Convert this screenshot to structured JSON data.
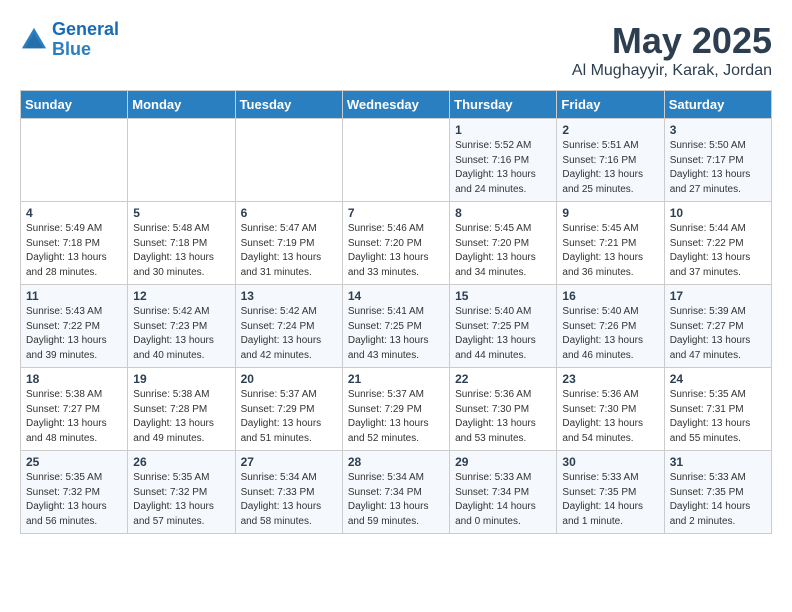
{
  "header": {
    "logo_line1": "General",
    "logo_line2": "Blue",
    "month": "May 2025",
    "location": "Al Mughayyir, Karak, Jordan"
  },
  "weekdays": [
    "Sunday",
    "Monday",
    "Tuesday",
    "Wednesday",
    "Thursday",
    "Friday",
    "Saturday"
  ],
  "weeks": [
    [
      {
        "day": "",
        "info": ""
      },
      {
        "day": "",
        "info": ""
      },
      {
        "day": "",
        "info": ""
      },
      {
        "day": "",
        "info": ""
      },
      {
        "day": "1",
        "info": "Sunrise: 5:52 AM\nSunset: 7:16 PM\nDaylight: 13 hours\nand 24 minutes."
      },
      {
        "day": "2",
        "info": "Sunrise: 5:51 AM\nSunset: 7:16 PM\nDaylight: 13 hours\nand 25 minutes."
      },
      {
        "day": "3",
        "info": "Sunrise: 5:50 AM\nSunset: 7:17 PM\nDaylight: 13 hours\nand 27 minutes."
      }
    ],
    [
      {
        "day": "4",
        "info": "Sunrise: 5:49 AM\nSunset: 7:18 PM\nDaylight: 13 hours\nand 28 minutes."
      },
      {
        "day": "5",
        "info": "Sunrise: 5:48 AM\nSunset: 7:18 PM\nDaylight: 13 hours\nand 30 minutes."
      },
      {
        "day": "6",
        "info": "Sunrise: 5:47 AM\nSunset: 7:19 PM\nDaylight: 13 hours\nand 31 minutes."
      },
      {
        "day": "7",
        "info": "Sunrise: 5:46 AM\nSunset: 7:20 PM\nDaylight: 13 hours\nand 33 minutes."
      },
      {
        "day": "8",
        "info": "Sunrise: 5:45 AM\nSunset: 7:20 PM\nDaylight: 13 hours\nand 34 minutes."
      },
      {
        "day": "9",
        "info": "Sunrise: 5:45 AM\nSunset: 7:21 PM\nDaylight: 13 hours\nand 36 minutes."
      },
      {
        "day": "10",
        "info": "Sunrise: 5:44 AM\nSunset: 7:22 PM\nDaylight: 13 hours\nand 37 minutes."
      }
    ],
    [
      {
        "day": "11",
        "info": "Sunrise: 5:43 AM\nSunset: 7:22 PM\nDaylight: 13 hours\nand 39 minutes."
      },
      {
        "day": "12",
        "info": "Sunrise: 5:42 AM\nSunset: 7:23 PM\nDaylight: 13 hours\nand 40 minutes."
      },
      {
        "day": "13",
        "info": "Sunrise: 5:42 AM\nSunset: 7:24 PM\nDaylight: 13 hours\nand 42 minutes."
      },
      {
        "day": "14",
        "info": "Sunrise: 5:41 AM\nSunset: 7:25 PM\nDaylight: 13 hours\nand 43 minutes."
      },
      {
        "day": "15",
        "info": "Sunrise: 5:40 AM\nSunset: 7:25 PM\nDaylight: 13 hours\nand 44 minutes."
      },
      {
        "day": "16",
        "info": "Sunrise: 5:40 AM\nSunset: 7:26 PM\nDaylight: 13 hours\nand 46 minutes."
      },
      {
        "day": "17",
        "info": "Sunrise: 5:39 AM\nSunset: 7:27 PM\nDaylight: 13 hours\nand 47 minutes."
      }
    ],
    [
      {
        "day": "18",
        "info": "Sunrise: 5:38 AM\nSunset: 7:27 PM\nDaylight: 13 hours\nand 48 minutes."
      },
      {
        "day": "19",
        "info": "Sunrise: 5:38 AM\nSunset: 7:28 PM\nDaylight: 13 hours\nand 49 minutes."
      },
      {
        "day": "20",
        "info": "Sunrise: 5:37 AM\nSunset: 7:29 PM\nDaylight: 13 hours\nand 51 minutes."
      },
      {
        "day": "21",
        "info": "Sunrise: 5:37 AM\nSunset: 7:29 PM\nDaylight: 13 hours\nand 52 minutes."
      },
      {
        "day": "22",
        "info": "Sunrise: 5:36 AM\nSunset: 7:30 PM\nDaylight: 13 hours\nand 53 minutes."
      },
      {
        "day": "23",
        "info": "Sunrise: 5:36 AM\nSunset: 7:30 PM\nDaylight: 13 hours\nand 54 minutes."
      },
      {
        "day": "24",
        "info": "Sunrise: 5:35 AM\nSunset: 7:31 PM\nDaylight: 13 hours\nand 55 minutes."
      }
    ],
    [
      {
        "day": "25",
        "info": "Sunrise: 5:35 AM\nSunset: 7:32 PM\nDaylight: 13 hours\nand 56 minutes."
      },
      {
        "day": "26",
        "info": "Sunrise: 5:35 AM\nSunset: 7:32 PM\nDaylight: 13 hours\nand 57 minutes."
      },
      {
        "day": "27",
        "info": "Sunrise: 5:34 AM\nSunset: 7:33 PM\nDaylight: 13 hours\nand 58 minutes."
      },
      {
        "day": "28",
        "info": "Sunrise: 5:34 AM\nSunset: 7:34 PM\nDaylight: 13 hours\nand 59 minutes."
      },
      {
        "day": "29",
        "info": "Sunrise: 5:33 AM\nSunset: 7:34 PM\nDaylight: 14 hours\nand 0 minutes."
      },
      {
        "day": "30",
        "info": "Sunrise: 5:33 AM\nSunset: 7:35 PM\nDaylight: 14 hours\nand 1 minute."
      },
      {
        "day": "31",
        "info": "Sunrise: 5:33 AM\nSunset: 7:35 PM\nDaylight: 14 hours\nand 2 minutes."
      }
    ]
  ]
}
